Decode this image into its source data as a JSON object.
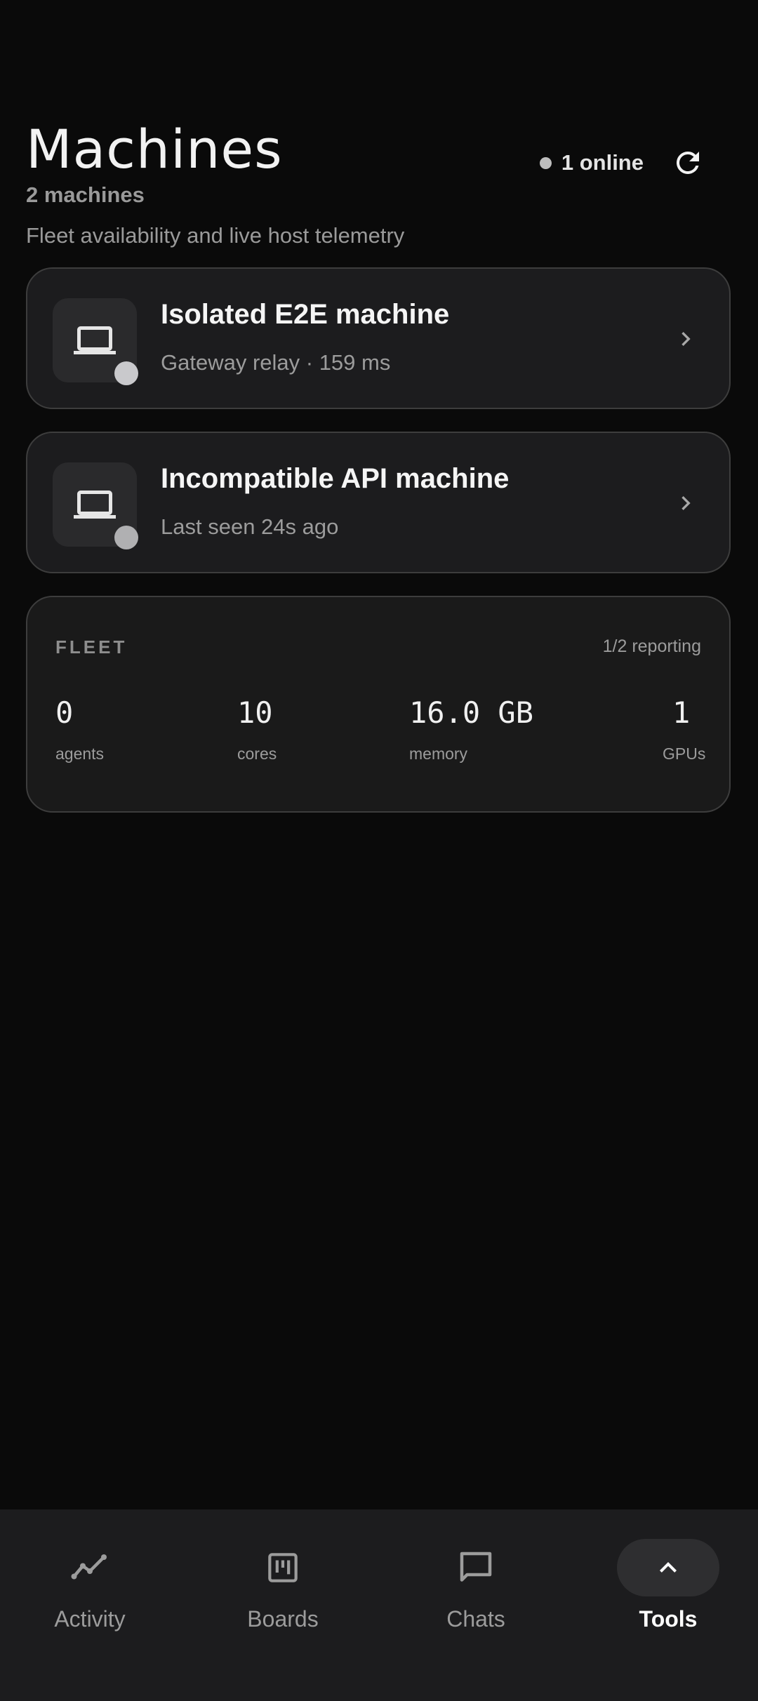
{
  "header": {
    "title": "Machines",
    "count_label": "2 machines",
    "description": "Fleet availability and live host telemetry",
    "online_label": "1 online",
    "refresh_icon": "refresh-icon"
  },
  "machines": [
    {
      "name": "Isolated E2E machine",
      "meta": "Gateway relay · 159 ms",
      "icon": "laptop-icon",
      "status_color": "#c9c9cc"
    },
    {
      "name": "Incompatible API machine",
      "meta": "Last seen 24s ago",
      "icon": "laptop-icon",
      "status_color": "#b0b0b2"
    }
  ],
  "fleet": {
    "title": "FLEET",
    "reporting": "1/2 reporting",
    "stats": [
      {
        "value": "0",
        "label": "agents"
      },
      {
        "value": "10",
        "label": "cores"
      },
      {
        "value": "16.0 GB",
        "label": "memory"
      },
      {
        "value": "1",
        "label": "GPUs"
      }
    ]
  },
  "nav": {
    "items": [
      {
        "label": "Activity",
        "icon": "activity-icon",
        "active": false
      },
      {
        "label": "Boards",
        "icon": "boards-icon",
        "active": false
      },
      {
        "label": "Chats",
        "icon": "chat-icon",
        "active": false
      },
      {
        "label": "Tools",
        "icon": "chevron-up-icon",
        "active": true
      }
    ]
  },
  "colors": {
    "background": "#0a0a0a",
    "card": "#1c1c1e",
    "border": "#3d3d3d",
    "muted_text": "#9c9c9c"
  }
}
